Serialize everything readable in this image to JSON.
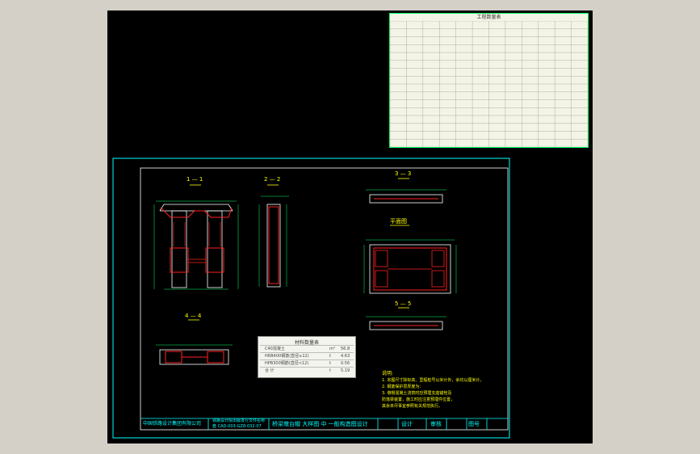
{
  "title_block": {
    "company": "中国铁路设计集团有限公司",
    "project": "铁路设计院出版发行文件名称",
    "drawing_number": "叁 CAD-003-GZ8-032-07",
    "drawing_name": "桥梁墩台帽 大样图 中 一般构造图设计",
    "cell_a": "设计",
    "cell_b": "审核",
    "cell_c": "图号"
  },
  "quantity_table": {
    "title": "工程数量表",
    "rows": 16,
    "cols": 12
  },
  "views": {
    "view_a": "1 — 1",
    "view_b": "2 — 2",
    "view_c": "3 — 3",
    "view_d": "4 — 4",
    "view_e": "平面图",
    "view_f": "5 — 5"
  },
  "legend": {
    "title": "材料数量表",
    "rows": [
      {
        "name": "C40混凝土",
        "unit": "m³",
        "qty": "56.8"
      },
      {
        "name": "HRB400钢筋(直径≥12)",
        "unit": "t",
        "qty": "4.63"
      },
      {
        "name": "HPB300钢筋(直径<12)",
        "unit": "t",
        "qty": "0.56"
      },
      {
        "name": "合 计",
        "unit": "t",
        "qty": "5.19"
      }
    ]
  },
  "notes": {
    "heading": "说明:",
    "lines": [
      "1. 本图尺寸除标高、里程桩号以米计外，余均以厘米计。",
      "2. 钢筋保护层厚度为：",
      "3. 墩帽混凝土浇筑时应预埋支座锚栓及",
      "   防落梁装置，施工时应注意预埋件位置，",
      "   其余未尽事宜参照有关规范执行。"
    ]
  },
  "colors": {
    "background": "#000000",
    "frame": "#00ffff",
    "outline": "#ffffff",
    "rebar": "#ff2020",
    "dimension": "#00ff66",
    "text": "#ffff00",
    "table_bg": "#f4f4e6"
  }
}
